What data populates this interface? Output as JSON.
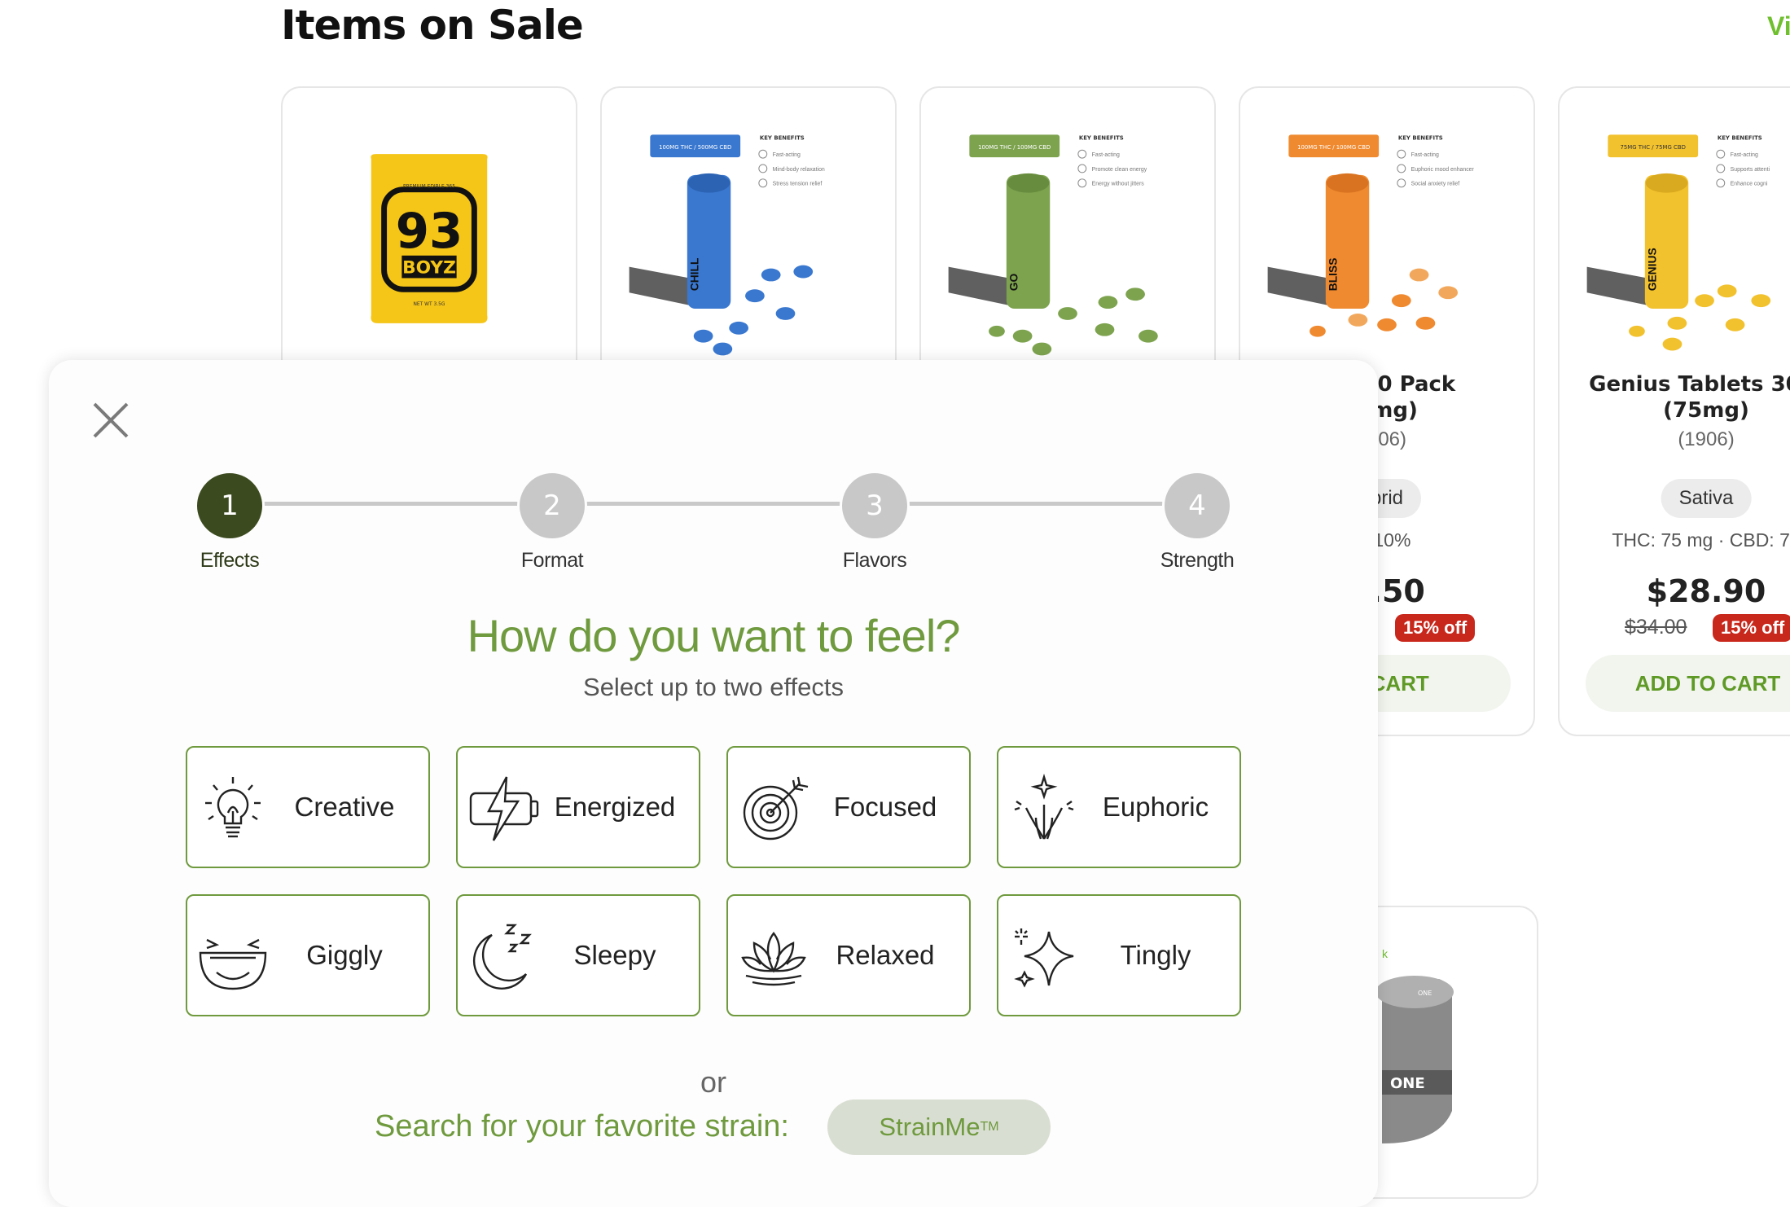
{
  "page": {
    "section_title": "Items on Sale",
    "view_all": "Vi"
  },
  "products": [
    {
      "name": "",
      "reviews": "",
      "tag": "",
      "potency": "",
      "price": "",
      "original_price": "",
      "discount": "",
      "cart_label": "",
      "image": {
        "label_top": "PREMIUM EDIBLE 365",
        "brand": "93",
        "sub": "BOYZ",
        "footer": "NET WT 3.5G",
        "color": "#f5c518"
      }
    },
    {
      "name": "",
      "reviews": "",
      "tag": "",
      "potency": "",
      "price": "",
      "original_price": "",
      "discount": "",
      "cart_label": "",
      "image": {
        "badge": "100MG THC / 500MG CBD",
        "product": "CHILL",
        "benefits_title": "KEY BENEFITS",
        "benefits": [
          "Fast-acting",
          "Mind-body relaxation",
          "Stress tension relief"
        ],
        "color": "#3a78d0"
      }
    },
    {
      "name": "",
      "reviews": "",
      "tag": "",
      "potency": "",
      "price": "",
      "original_price": "",
      "discount": "",
      "cart_label": "",
      "image": {
        "badge": "100MG THC / 100MG CBD",
        "product": "GO",
        "benefits_title": "KEY BENEFITS",
        "benefits": [
          "Fast-acting",
          "Promote clean energy",
          "Energy without jitters"
        ],
        "color": "#7da34f"
      }
    },
    {
      "name": "ets 20 Pack\n0mg)",
      "reviews": "906)",
      "tag": "brid",
      "potency": ": 10%",
      "price": "5.50",
      "original_price": "",
      "discount": "15% off",
      "cart_label": "O CART",
      "image": {
        "badge": "100MG THC / 100MG CBD",
        "product": "BLISS",
        "benefits_title": "KEY BENEFITS",
        "benefits": [
          "Fast-acting",
          "Euphoric mood enhancer",
          "Social anxiety relief"
        ],
        "color": "#f08a30"
      }
    },
    {
      "name": "Genius Tablets 30 P\n(75mg)",
      "reviews": "(1906)",
      "tag": "Sativa",
      "potency": "THC: 75 mg · CBD: 75",
      "price": "$28.90",
      "original_price": "$34.00",
      "discount": "15% off",
      "cart_label": "ADD TO CART",
      "image": {
        "badge": "75MG THC / 75MG CBD",
        "product": "GENIUS",
        "benefits_title": "KEY BENEFITS",
        "benefits": [
          "Fast-acting",
          "Supports attenti",
          "Enhance cogni"
        ],
        "color": "#f2c12e"
      }
    }
  ],
  "lower_card": {
    "label": "ONE",
    "top_label": "ONE"
  },
  "modal": {
    "steps": [
      {
        "number": "1",
        "label": "Effects",
        "active": true
      },
      {
        "number": "2",
        "label": "Format",
        "active": false
      },
      {
        "number": "3",
        "label": "Flavors",
        "active": false
      },
      {
        "number": "4",
        "label": "Strength",
        "active": false
      }
    ],
    "question": "How do you want to feel?",
    "subtitle": "Select up to two effects",
    "effects": [
      {
        "label": "Creative",
        "icon": "lightbulb-icon"
      },
      {
        "label": "Energized",
        "icon": "battery-bolt-icon"
      },
      {
        "label": "Focused",
        "icon": "target-icon"
      },
      {
        "label": "Euphoric",
        "icon": "fireworks-icon"
      },
      {
        "label": "Giggly",
        "icon": "laughing-face-icon"
      },
      {
        "label": "Sleepy",
        "icon": "moon-zzz-icon"
      },
      {
        "label": "Relaxed",
        "icon": "lotus-icon"
      },
      {
        "label": "Tingly",
        "icon": "sparkle-icon"
      }
    ],
    "or_text": "or",
    "search_text": "Search for your favorite strain:",
    "strainme_label": "StrainMe",
    "strainme_tm": "TM"
  },
  "colors": {
    "accent_green": "#6f9a3e",
    "active_step": "#3c4b1f",
    "discount_red": "#c8271b",
    "view_all_green": "#6fbf2e"
  }
}
